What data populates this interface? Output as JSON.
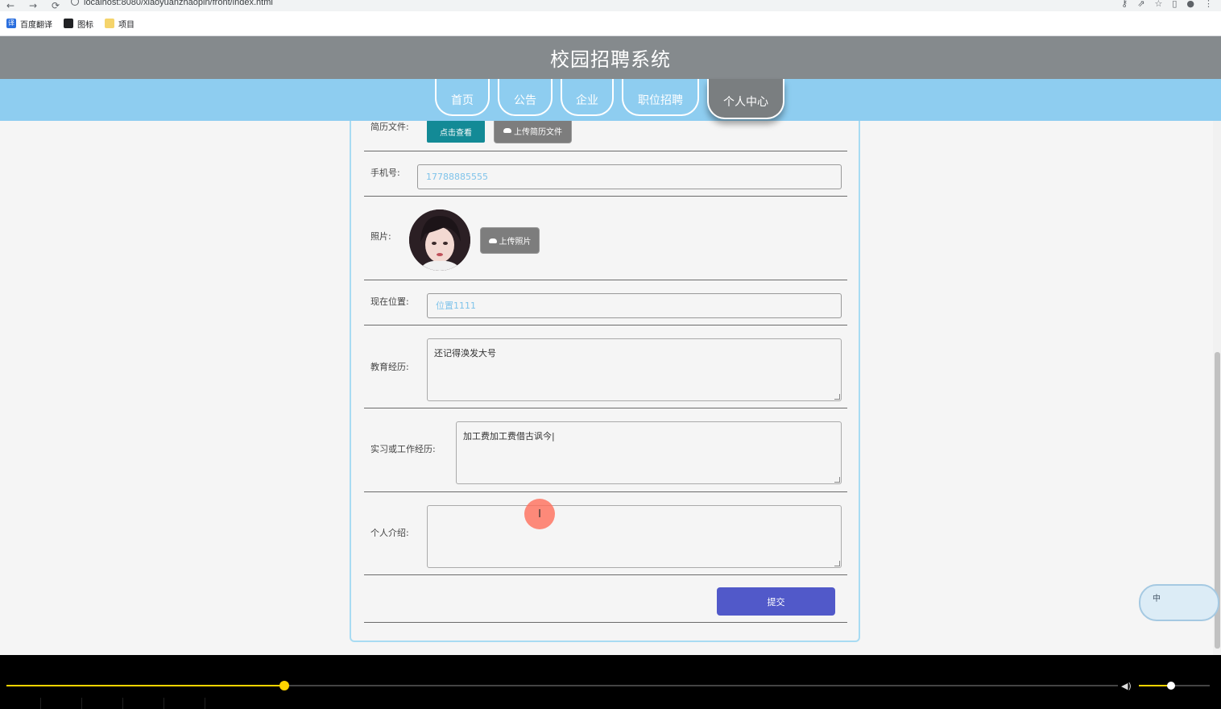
{
  "browser": {
    "url": "localhost:8080/xiaoyuanzhaopin/front/index.html",
    "bookmarks": [
      "百度翻译",
      "图标",
      "项目"
    ]
  },
  "site": {
    "title": "校园招聘系统",
    "nav": [
      "首页",
      "公告",
      "企业",
      "职位招聘",
      "个人中心"
    ],
    "active_nav": "个人中心"
  },
  "form": {
    "resume_label": "简历文件:",
    "view_button": "点击查看",
    "upload_resume_button": "上传简历文件",
    "phone_label": "手机号:",
    "phone_value": "17788885555",
    "photo_label": "照片:",
    "upload_photo_button": "上传照片",
    "location_label": "现在位置:",
    "location_value": "位置1111",
    "education_label": "教育经历:",
    "education_value": "还记得涣发大号",
    "work_label": "实习或工作经历:",
    "work_value": "加工费加工费借古讽今|",
    "intro_label": "个人介绍:",
    "intro_value": "",
    "submit_button": "提交"
  },
  "widget": {
    "label": "中"
  },
  "player": {
    "progress": 0.25,
    "volume": 0.45
  },
  "icons": [
    "back-icon",
    "forward-icon",
    "reload-icon",
    "info-icon",
    "key-icon",
    "share-icon",
    "star-icon",
    "sidepanel-icon",
    "profile-icon",
    "menu-icon",
    "cloud-upload-icon",
    "text-cursor-icon",
    "volume-icon"
  ]
}
